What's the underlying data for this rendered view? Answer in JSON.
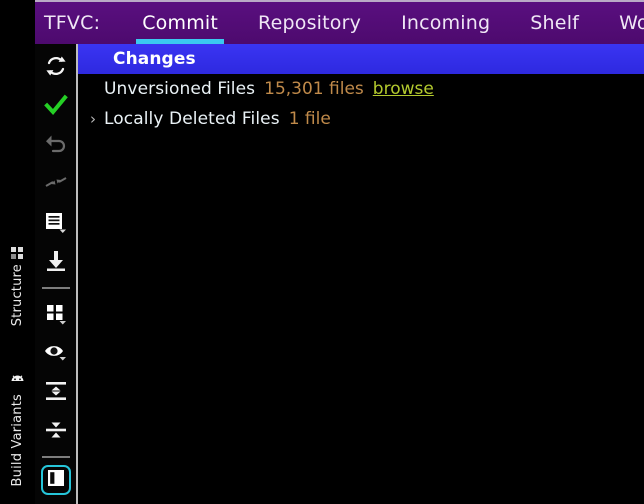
{
  "window": {
    "background": "#000000"
  },
  "header": {
    "prefix_label": "TFVC:",
    "accent_color": "#3bc9f0",
    "background_color": "#540b77",
    "tabs": [
      {
        "label": "Commit",
        "active": true
      },
      {
        "label": "Repository",
        "active": false
      },
      {
        "label": "Incoming",
        "active": false
      },
      {
        "label": "Shelf",
        "active": false
      },
      {
        "label": "Work Items",
        "active": false
      }
    ]
  },
  "tool_stripe": {
    "items": [
      {
        "label": "Structure",
        "icon": "structure-grid-icon"
      },
      {
        "label": "Build Variants",
        "icon": "android-robot-icon"
      }
    ]
  },
  "action_bar": {
    "buttons": [
      {
        "name": "refresh-button",
        "icon": "refresh-icon",
        "tint": "#ffffff"
      },
      {
        "name": "commit-checkmark-button",
        "icon": "checkmark-icon",
        "tint": "#3ecf3e"
      },
      {
        "name": "rollback-button",
        "icon": "undo-arrow-icon",
        "tint": "#6f6f6f"
      },
      {
        "name": "shelve-button",
        "icon": "arrows-collapse-icon",
        "tint": "#6f6f6f"
      },
      {
        "name": "changelist-button",
        "icon": "document-list-icon",
        "tint": "#ffffff"
      },
      {
        "name": "get-latest-button",
        "icon": "download-arrow-icon",
        "tint": "#ffffff"
      },
      {
        "name": "group-by-button",
        "icon": "grid-squares-icon",
        "tint": "#ffffff"
      },
      {
        "name": "preview-diff-button",
        "icon": "eye-icon",
        "tint": "#ffffff"
      },
      {
        "name": "expand-all-button",
        "icon": "expand-all-icon",
        "tint": "#ffffff"
      },
      {
        "name": "collapse-all-button",
        "icon": "collapse-all-icon",
        "tint": "#ffffff"
      },
      {
        "name": "toggle-panel-button",
        "icon": "panel-toggle-icon",
        "tint": "#ffffff",
        "selected": true
      }
    ]
  },
  "changes_tree": {
    "root": {
      "label": "Changes",
      "selected": true
    },
    "nodes": [
      {
        "label": "Unversioned Files",
        "count_text": "15,301 files",
        "link_text": "browse",
        "expandable": false,
        "expanded": false
      },
      {
        "label": "Locally Deleted Files",
        "count_text": "1 file",
        "link_text": "",
        "expandable": true,
        "expanded": false
      }
    ]
  },
  "colors": {
    "selection_blue": "#3333ee",
    "header_purple": "#540b77",
    "accent_cyan": "#3bc9f0",
    "count_orange": "#c08a4a",
    "link_green": "#b3c92e",
    "check_green": "#3ecf3e"
  }
}
